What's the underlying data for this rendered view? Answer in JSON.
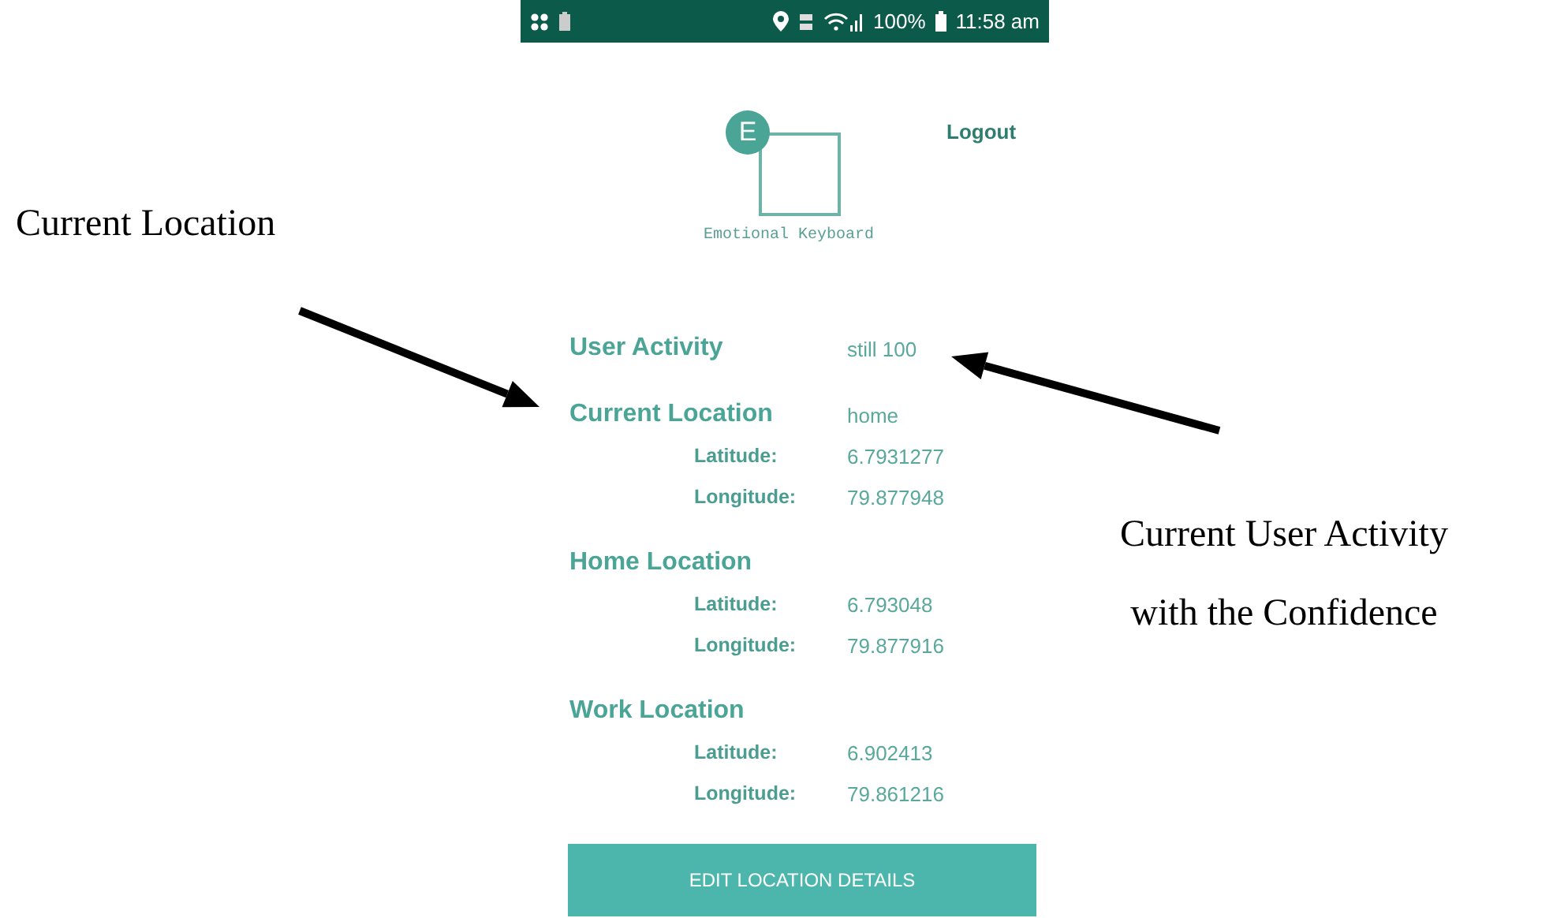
{
  "status_bar": {
    "battery_percent": "100%",
    "time": "11:58 am"
  },
  "header": {
    "logo_letter": "E",
    "logo_name": "Emotional Keyboard",
    "logout": "Logout"
  },
  "sections": [
    {
      "title": "User Activity",
      "value": "still 100"
    },
    {
      "title": "Current Location",
      "value": "home",
      "rows": [
        {
          "label": "Latitude:",
          "value": "6.7931277"
        },
        {
          "label": "Longitude:",
          "value": "79.877948"
        }
      ]
    },
    {
      "title": "Home Location",
      "rows": [
        {
          "label": "Latitude:",
          "value": "6.793048"
        },
        {
          "label": "Longitude:",
          "value": "79.877916"
        }
      ]
    },
    {
      "title": "Work Location",
      "rows": [
        {
          "label": "Latitude:",
          "value": "6.902413"
        },
        {
          "label": "Longitude:",
          "value": "79.861216"
        }
      ]
    }
  ],
  "button": "EDIT LOCATION DETAILS",
  "annotations": [
    {
      "lines": [
        "Current Location"
      ]
    },
    {
      "lines": [
        "Current User Activity",
        "with the Confidence"
      ]
    }
  ]
}
